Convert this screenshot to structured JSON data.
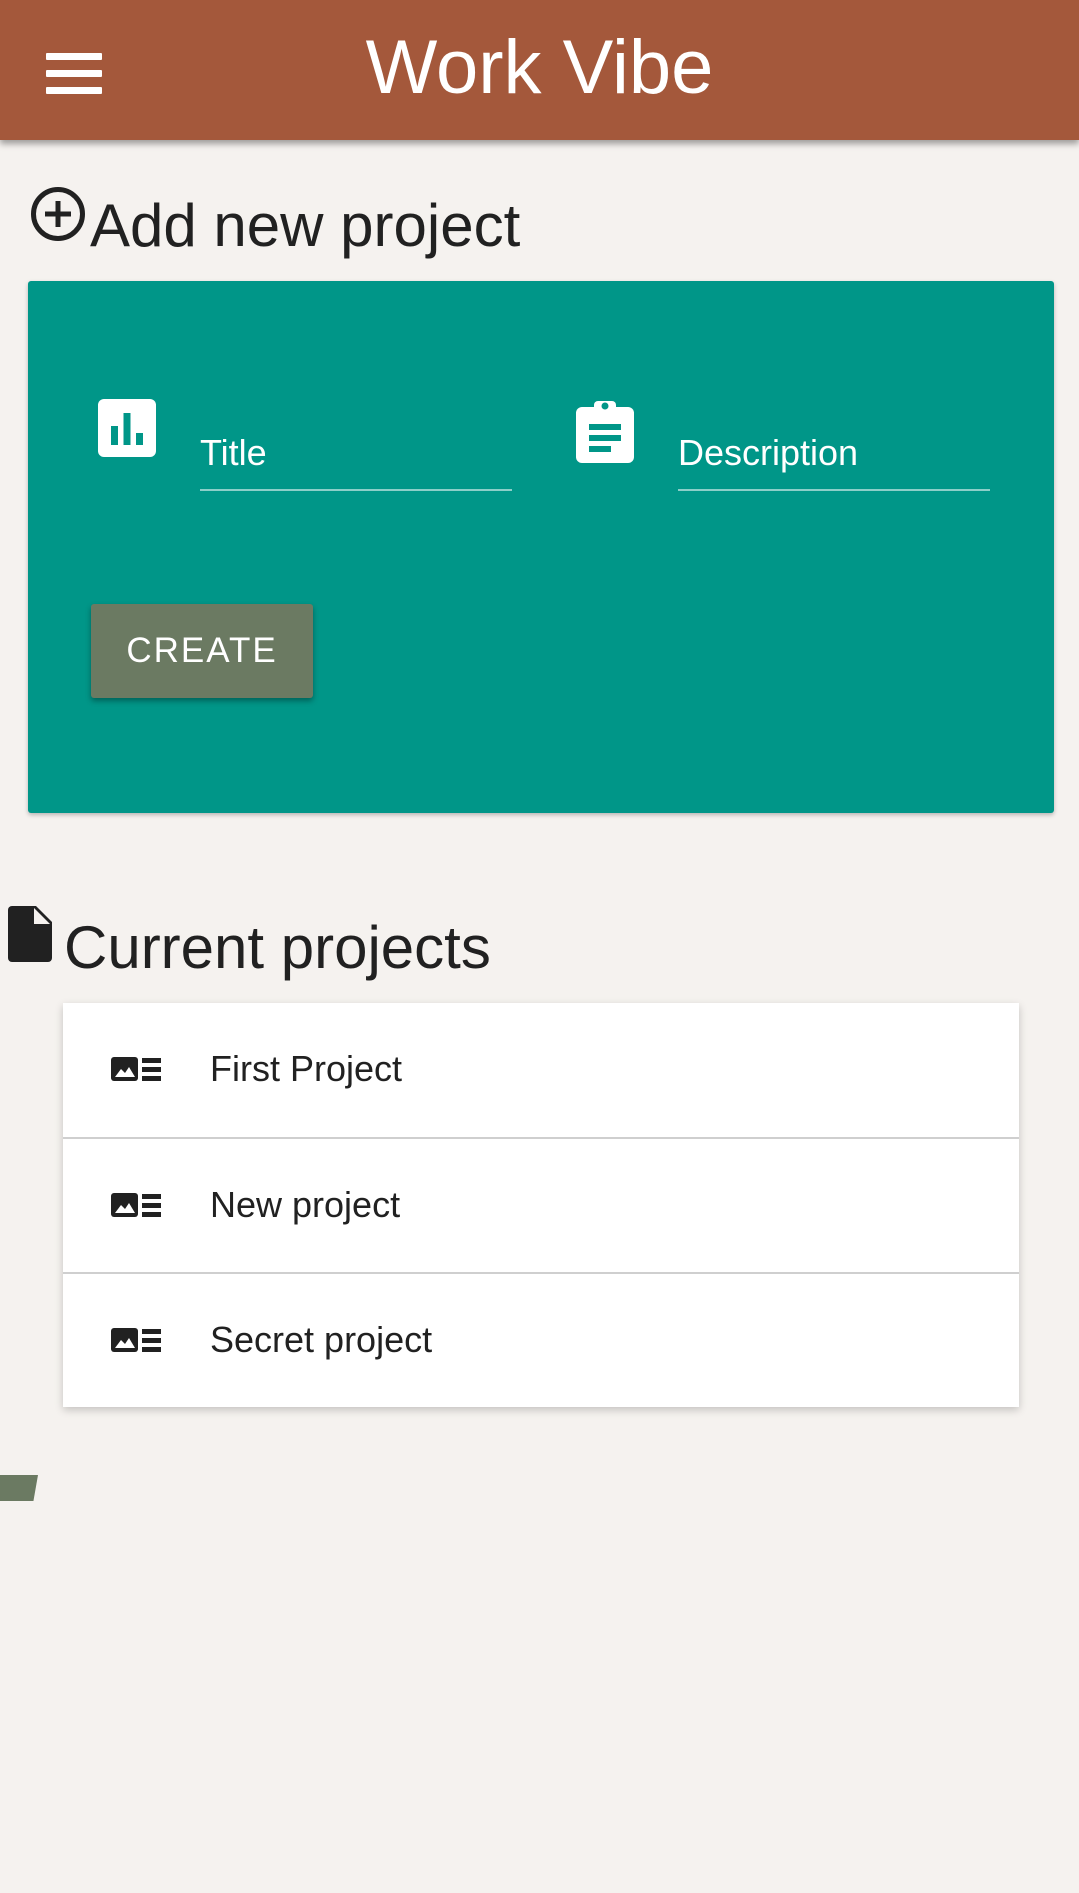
{
  "app": {
    "title": "Work Vibe",
    "menu_icon": "menu-icon"
  },
  "add_section": {
    "heading": "Add new project",
    "icon": "add-circle-icon",
    "card_color": "#009688",
    "title_field": {
      "icon": "bar-chart-icon",
      "placeholder": "Title",
      "value": ""
    },
    "description_field": {
      "icon": "clipboard-icon",
      "placeholder": "Description",
      "value": ""
    },
    "create_label": "CREATE"
  },
  "current_section": {
    "heading": "Current projects",
    "icon": "document-icon",
    "projects": [
      {
        "label": "First Project",
        "icon": "image-list-icon"
      },
      {
        "label": "New project",
        "icon": "image-list-icon"
      },
      {
        "label": "Secret project",
        "icon": "image-list-icon"
      }
    ]
  },
  "colors": {
    "app_bar": "#a4583b",
    "background": "#f5f2ef",
    "accent": "#009688",
    "button": "#6b7a62"
  }
}
